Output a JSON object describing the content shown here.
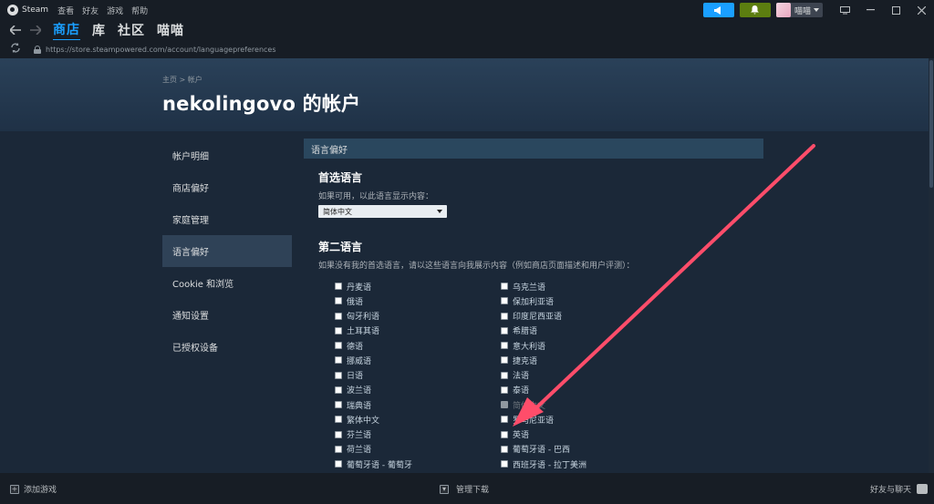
{
  "titlebar": {
    "app_name": "Steam",
    "menu": [
      "查看",
      "好友",
      "游戏",
      "帮助"
    ],
    "username": "喵喵"
  },
  "nav": {
    "tabs": [
      {
        "label": "商店",
        "active": true
      },
      {
        "label": "库",
        "active": false
      },
      {
        "label": "社区",
        "active": false
      },
      {
        "label": "喵喵",
        "active": false
      }
    ]
  },
  "url": "https://store.steampowered.com/account/languagepreferences",
  "page": {
    "breadcrumb": "主页 > 帐户",
    "title": "nekolingovo 的帐户"
  },
  "sidebar": {
    "items": [
      {
        "label": "帐户明细",
        "active": false
      },
      {
        "label": "商店偏好",
        "active": false
      },
      {
        "label": "家庭管理",
        "active": false
      },
      {
        "label": "语言偏好",
        "active": true
      },
      {
        "label": "Cookie 和浏览",
        "active": false
      },
      {
        "label": "通知设置",
        "active": false
      },
      {
        "label": "已授权设备",
        "active": false
      }
    ]
  },
  "main": {
    "section_header": "语言偏好",
    "primary": {
      "heading": "首选语言",
      "description": "如果可用，以此语言显示内容：",
      "selected": "简体中文"
    },
    "secondary": {
      "heading": "第二语言",
      "description": "如果没有我的首选语言，请以这些语言向我展示内容（例如商店页面描述和用户评测）："
    },
    "languages_left": [
      "丹麦语",
      "俄语",
      "匈牙利语",
      "土耳其语",
      "德语",
      "挪威语",
      "日语",
      "波兰语",
      "瑞典语",
      "繁体中文",
      "芬兰语",
      "荷兰语",
      "葡萄牙语 - 葡萄牙"
    ],
    "languages_right": [
      "乌克兰语",
      "保加利亚语",
      "印度尼西亚语",
      "希腊语",
      "意大利语",
      "捷克语",
      "法语",
      "泰语",
      "简体中文",
      "罗马尼亚语",
      "英语",
      "葡萄牙语 - 巴西",
      "西班牙语 - 拉丁美洲"
    ],
    "disabled_language": "简体中文"
  },
  "bottom": {
    "add_game": "添加游戏",
    "manage_downloads": "管理下载",
    "friends_chat": "好友与聊天"
  },
  "colors": {
    "accent": "#1a9fff",
    "annotation_arrow": "#ff4d6a"
  }
}
